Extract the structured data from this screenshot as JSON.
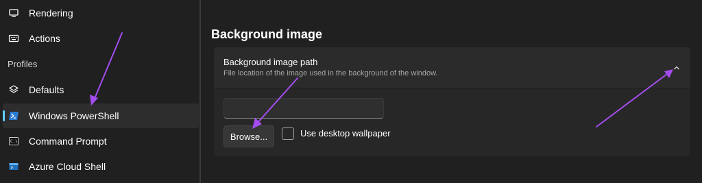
{
  "sidebar": {
    "items": [
      {
        "label": "Rendering",
        "icon": "monitor-icon"
      },
      {
        "label": "Actions",
        "icon": "keyboard-icon"
      },
      {
        "label": "Defaults",
        "icon": "layers-icon"
      },
      {
        "label": "Windows PowerShell",
        "icon": "powershell-icon"
      },
      {
        "label": "Command Prompt",
        "icon": "cmd-icon"
      },
      {
        "label": "Azure Cloud Shell",
        "icon": "azure-icon"
      }
    ],
    "profiles_header": "Profiles"
  },
  "main": {
    "page_title": "Background image",
    "card": {
      "title": "Background image path",
      "description": "File location of the image used in the background of the window.",
      "path_value": "",
      "browse_label": "Browse...",
      "checkbox_label": "Use desktop wallpaper",
      "checkbox_checked": false
    }
  },
  "colors": {
    "background": "#202020",
    "card": "#2b2b2b",
    "accent": "#60cdff",
    "annotation_arrow": "#a34df0"
  }
}
